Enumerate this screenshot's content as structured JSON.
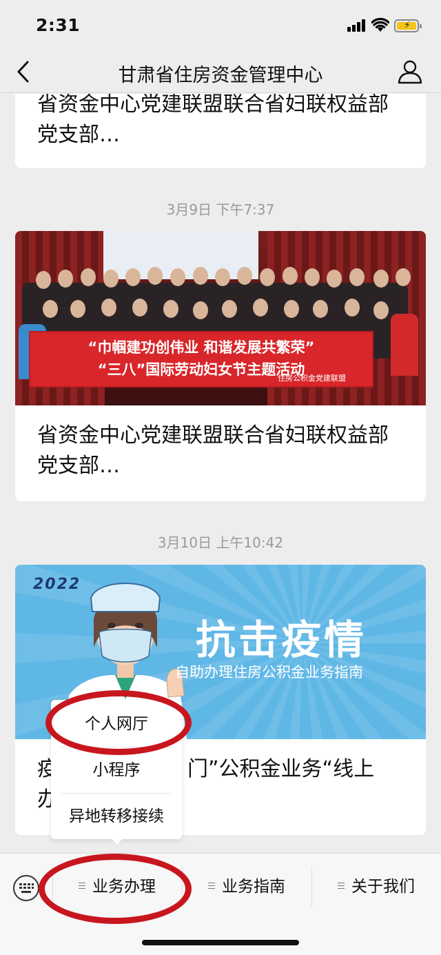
{
  "status_bar": {
    "time": "2:31"
  },
  "header": {
    "title": "甘肃省住房资金管理中心"
  },
  "feed": [
    {
      "type": "article",
      "title_line1": "省资金中心党建联盟联合省妇联权益部",
      "title_line2": "党支部…"
    },
    {
      "type": "timestamp",
      "text": "3月9日 下午7:37"
    },
    {
      "type": "article",
      "banner_line1": "“巾帼建功创伟业  和谐发展共繁荣”",
      "banner_line2": "“三八”国际劳动妇女节主题活动",
      "banner_org": "住房公积金党建联盟",
      "title_line1": "省资金中心党建联盟联合省妇联权益部",
      "title_line2": "党支部…"
    },
    {
      "type": "timestamp",
      "text": "3月10日 上午10:42"
    },
    {
      "type": "article",
      "year": "2022",
      "headline": "抗击疫情",
      "subheadline": "自助办理住房公积金业务指南",
      "title_line1_a": "疫",
      "title_line1_b": "门”公积金业务“线上",
      "title_line2": "办"
    }
  ],
  "popup_menu": {
    "items": [
      "个人网厅",
      "小程序",
      "异地转移接续"
    ]
  },
  "bottom_menu": {
    "tabs": [
      "业务办理",
      "业务指南",
      "关于我们"
    ]
  },
  "colors": {
    "annotation": "#c8161e",
    "banner_red": "#d8262a",
    "covid_blue": "#5fb7e6"
  }
}
